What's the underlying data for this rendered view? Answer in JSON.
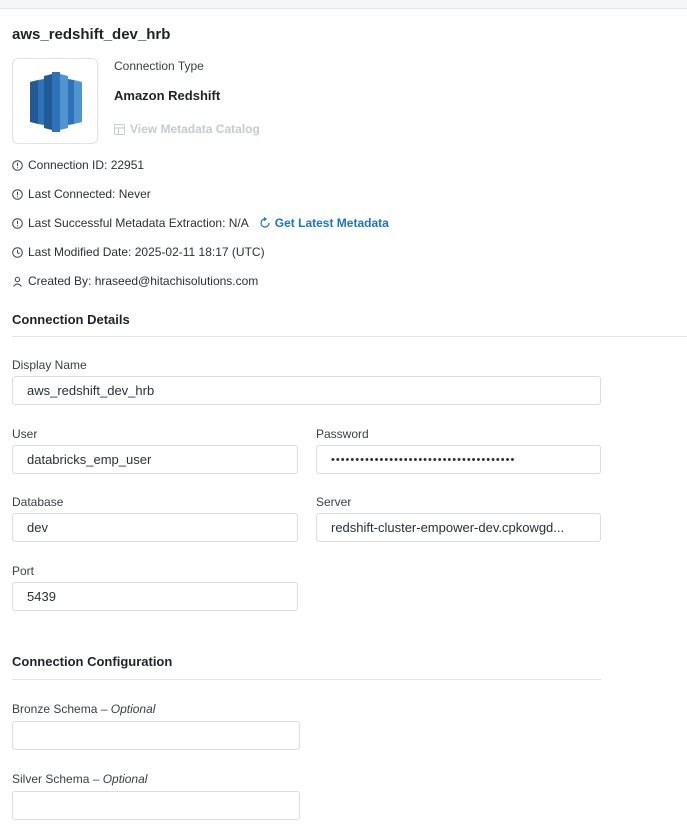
{
  "page": {
    "title": "aws_redshift_dev_hrb"
  },
  "connection": {
    "type_label": "Connection Type",
    "type_value": "Amazon Redshift",
    "catalog_link": "View Metadata Catalog",
    "logo_icon": "amazon-redshift-logo"
  },
  "meta": {
    "connection_id": "Connection ID: 22951",
    "last_connected": "Last Connected: Never",
    "last_extraction": "Last Successful Metadata Extraction: N/A",
    "get_latest": "Get Latest Metadata",
    "last_modified": "Last Modified Date: 2025-02-11 18:17 (UTC)",
    "created_by": "Created By: hraseed@hitachisolutions.com"
  },
  "details": {
    "section_title": "Connection Details",
    "display_name_label": "Display Name",
    "display_name_value": "aws_redshift_dev_hrb",
    "user_label": "User",
    "user_value": "databricks_emp_user",
    "password_label": "Password",
    "password_value": "••••••••••••••••••••••••••••••••••••••",
    "database_label": "Database",
    "database_value": "dev",
    "server_label": "Server",
    "server_value": "redshift-cluster-empower-dev.cpkowgd...",
    "port_label": "Port",
    "port_value": "5439"
  },
  "configuration": {
    "section_title": "Connection Configuration",
    "bronze_label": "Bronze Schema",
    "silver_label": "Silver Schema",
    "optional_text": "– Optional",
    "bronze_value": "",
    "silver_value": ""
  },
  "colors": {
    "link": "#1a73c9",
    "redshift_dark": "#205b98",
    "redshift_mid": "#2e73b8",
    "redshift_light": "#5294cf"
  }
}
